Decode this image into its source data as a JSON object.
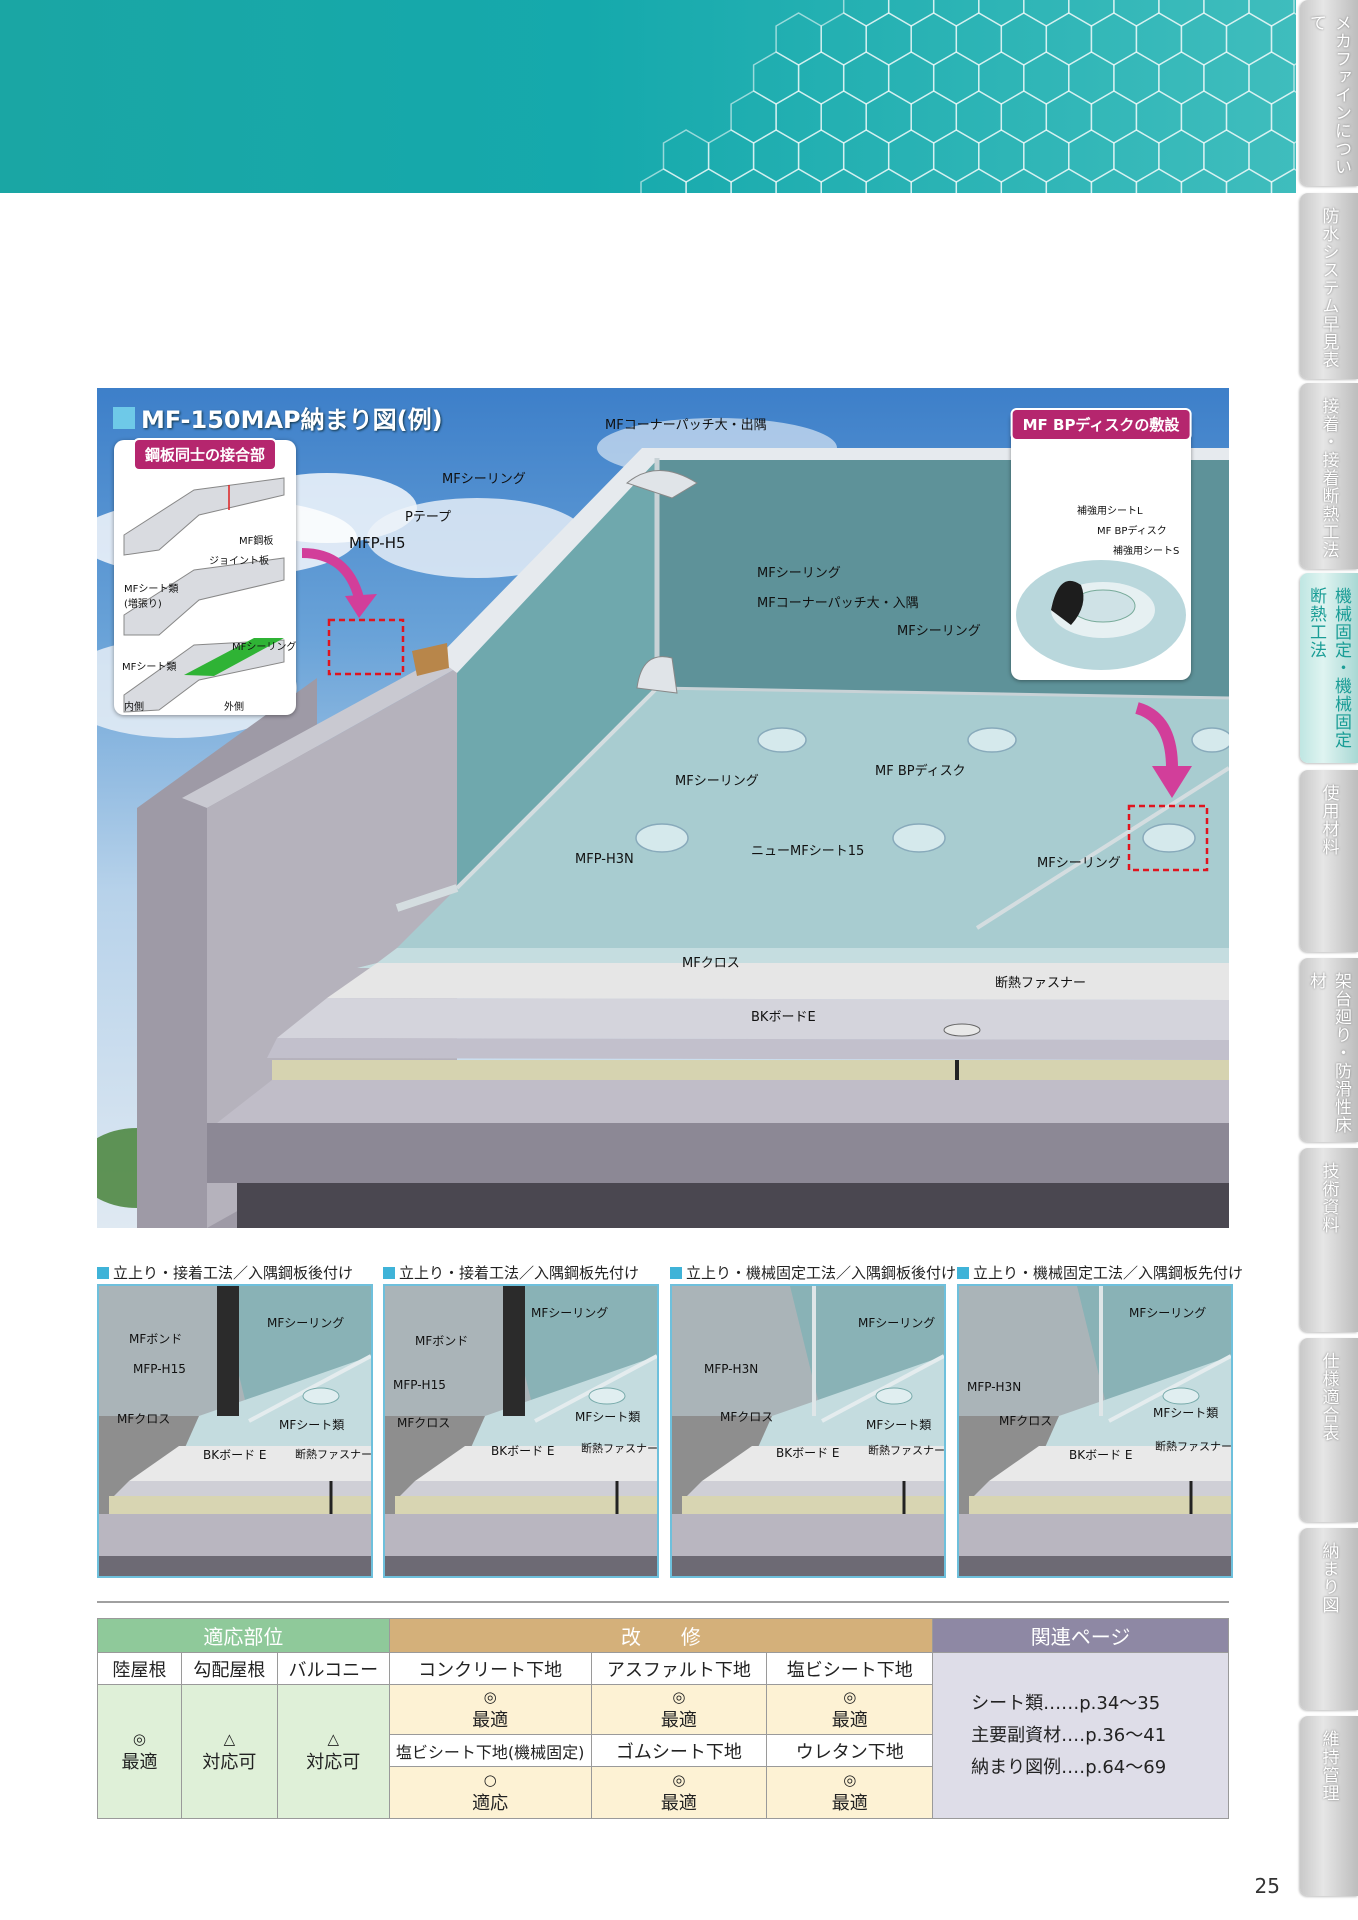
{
  "side_tabs": [
    {
      "label": "メカファインについて",
      "active": false
    },
    {
      "label": "防水システム早見表",
      "active": false
    },
    {
      "label": "接着・接着断熱工法",
      "active": false
    },
    {
      "label": "機械固定・機械固定断熱工法",
      "active": true
    },
    {
      "label": "使用材料",
      "active": false
    },
    {
      "label": "架台廻り・防滑性床材",
      "active": false
    },
    {
      "label": "技術資料",
      "active": false
    },
    {
      "label": "仕様適合表",
      "active": false
    },
    {
      "label": "納まり図",
      "active": false
    },
    {
      "label": "維持管理",
      "active": false
    }
  ],
  "page_number": "25",
  "colors": {
    "header": "#1aa6a4",
    "accent_magenta": "#b5266e",
    "highlight_box": "#e0141e"
  },
  "main_figure": {
    "title": "MF-150MAP納まり図(例)",
    "labels": {
      "corner_patch_out": "MFコーナーパッチ大・出隅",
      "sealing_top": "MFシーリング",
      "p_tape": "Pテープ",
      "mfp_h5": "MFP-H5",
      "sealing_mid": "MFシーリング",
      "corner_patch_in": "MFコーナーパッチ大・入隅",
      "sealing_right": "MFシーリング",
      "sealing_left": "MFシーリング",
      "bp_disk": "MF BPディスク",
      "mfp_h3n": "MFP-H3N",
      "new_sheet": "ニューMFシート15",
      "sealing_front": "MFシーリング",
      "cloth": "MFクロス",
      "fastener": "断熱ファスナー",
      "board": "BKボードE"
    },
    "joint_inset": {
      "heading": "鋼板同士の接合部",
      "steel": "MF鋼板",
      "joint_plate": "ジョイント板",
      "sheet_extra": "MFシート類\n(増張り)",
      "sealing": "MFシーリング",
      "sheet": "MFシート類",
      "inside": "内側",
      "outside": "外側"
    },
    "disk_inset": {
      "heading": "MF BPディスクの敷設",
      "sheet_l": "補強用シートL",
      "disk": "MF BPディスク",
      "sheet_s": "補強用シートS"
    }
  },
  "sub_figures": [
    {
      "title": "立上り・接着工法／入隅鋼板後付け",
      "labels": {
        "a": "MFボンド",
        "b": "MFシーリング",
        "c": "MFP-H15",
        "d": "MFクロス",
        "e": "MFシート類",
        "f": "BKボード E",
        "g": "断熱ファスナー"
      }
    },
    {
      "title": "立上り・接着工法／入隅鋼板先付け",
      "labels": {
        "a": "MFボンド",
        "b": "MFシーリング",
        "c": "MFP-H15",
        "d": "MFクロス",
        "e": "MFシート類",
        "f": "BKボード E",
        "g": "断熱ファスナー"
      }
    },
    {
      "title": "立上り・機械固定工法／入隅鋼板後付け",
      "labels": {
        "a": "MFP-H3N",
        "b": "MFシーリング",
        "c": "MFクロス",
        "d": "MFシート類",
        "e": "BKボード E",
        "f": "断熱ファスナー"
      }
    },
    {
      "title": "立上り・機械固定工法／入隅鋼板先付け",
      "labels": {
        "a": "MFP-H3N",
        "b": "MFシーリング",
        "c": "MFクロス",
        "d": "MFシート類",
        "e": "BKボード E",
        "f": "断熱ファスナー"
      }
    }
  ],
  "suitability_table": {
    "group_headers": {
      "applicable": "適応部位",
      "renovation": "改　　修",
      "related": "関連ページ"
    },
    "applicable": [
      {
        "name": "陸屋根",
        "symbol": "◎",
        "rating": "最適"
      },
      {
        "name": "勾配屋根",
        "symbol": "△",
        "rating": "対応可"
      },
      {
        "name": "バルコニー",
        "symbol": "△",
        "rating": "対応可"
      }
    ],
    "renovation_row1": [
      {
        "name": "コンクリート下地",
        "symbol": "◎",
        "rating": "最適"
      },
      {
        "name": "アスファルト下地",
        "symbol": "◎",
        "rating": "最適"
      },
      {
        "name": "塩ビシート下地",
        "symbol": "◎",
        "rating": "最適"
      }
    ],
    "renovation_row2": [
      {
        "name": "塩ビシート下地(機械固定)",
        "symbol": "○",
        "rating": "適応"
      },
      {
        "name": "ゴムシート下地",
        "symbol": "◎",
        "rating": "最適"
      },
      {
        "name": "ウレタン下地",
        "symbol": "◎",
        "rating": "最適"
      }
    ],
    "related_pages": [
      "シート類‥‥‥p.34〜35",
      "主要副資材‥‥p.36〜41",
      "納まり図例‥‥p.64〜69"
    ]
  }
}
